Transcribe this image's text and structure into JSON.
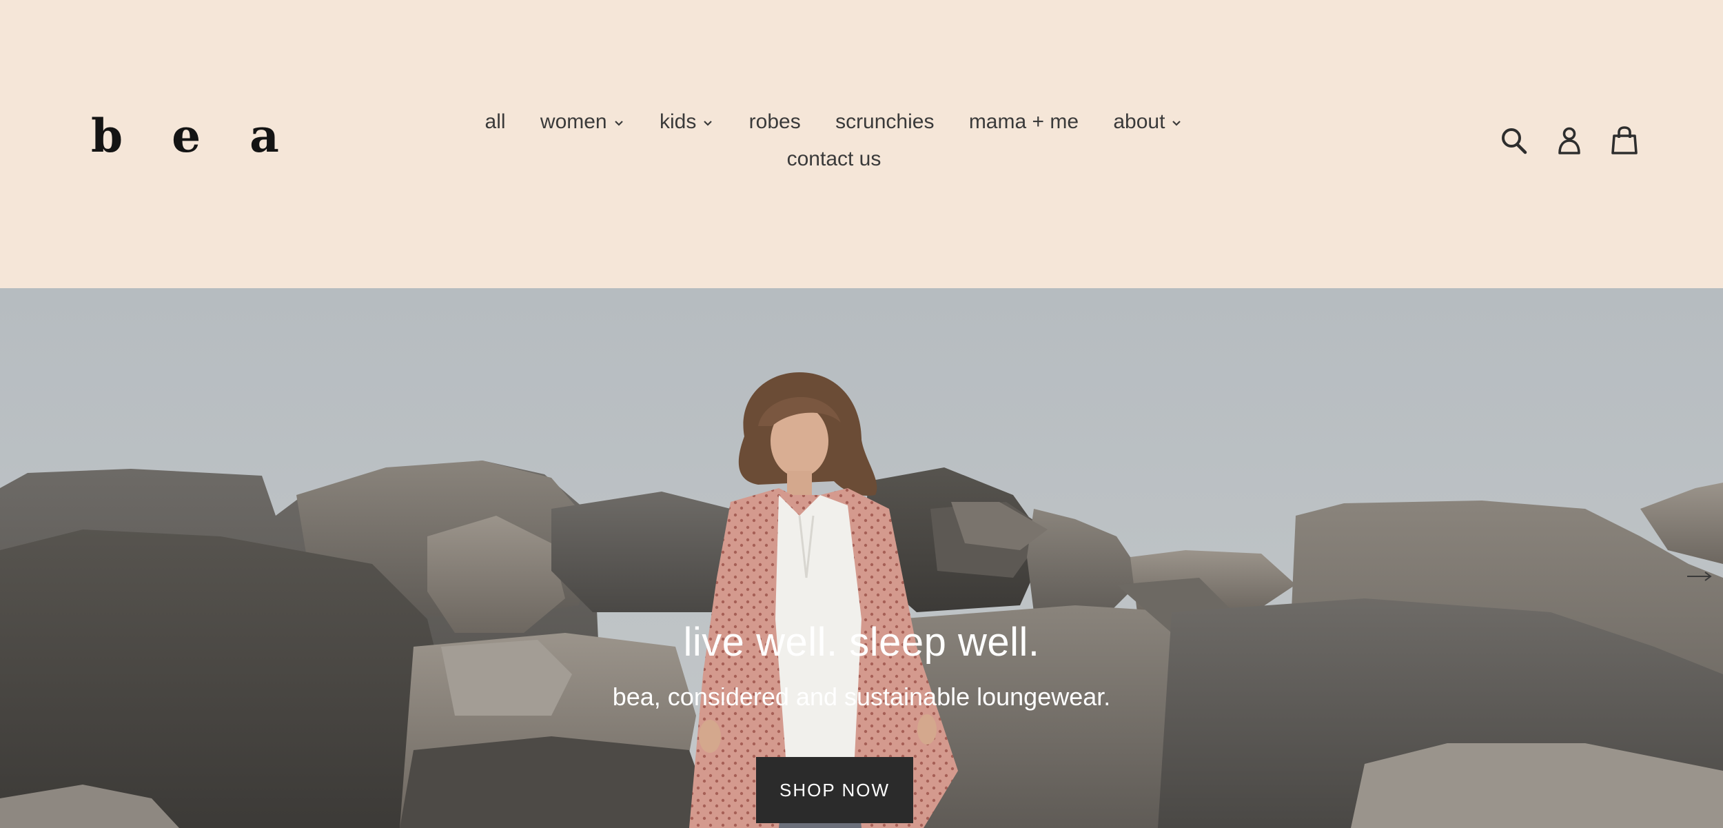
{
  "brand": {
    "logo": "b e a"
  },
  "nav": {
    "items": [
      {
        "label": "all",
        "dropdown": false
      },
      {
        "label": "women",
        "dropdown": true
      },
      {
        "label": "kids",
        "dropdown": true
      },
      {
        "label": "robes",
        "dropdown": false
      },
      {
        "label": "scrunchies",
        "dropdown": false
      },
      {
        "label": "mama + me",
        "dropdown": false
      },
      {
        "label": "about",
        "dropdown": true
      },
      {
        "label": "contact us",
        "dropdown": false
      }
    ]
  },
  "header_icons": [
    "search-icon",
    "account-icon",
    "cart-icon"
  ],
  "hero": {
    "title": "live well. sleep well.",
    "subtitle": "bea, considered and sustainable loungewear.",
    "cta_label": "SHOP NOW"
  },
  "colors": {
    "header_bg": "#f5e6d8",
    "text": "#3a3a3a",
    "button_bg": "#2b2b2b",
    "button_text": "#ffffff"
  }
}
